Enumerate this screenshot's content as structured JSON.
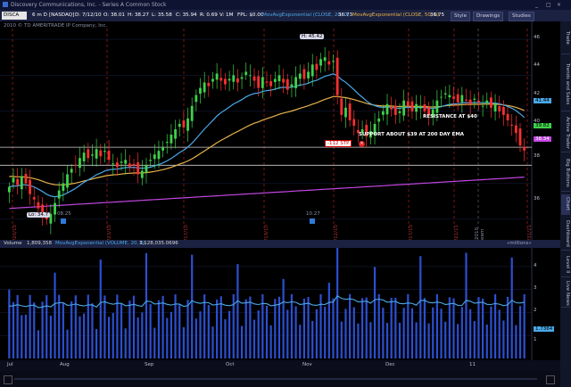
{
  "window": {
    "title": "Discovery Communications, Inc. - Series A Common Stock",
    "controls": [
      "_",
      "□",
      "×"
    ]
  },
  "toolbar": {
    "symbol": "DISCA",
    "timeframe_label": "6 m D",
    "exchange": "[NASDAQ]",
    "date": "D: 7/12/10",
    "open": "O: 38.01",
    "high": "H: 38.27",
    "low": "L: 35.58",
    "close": "C: 35.94",
    "range": "R: 0.69",
    "volume": "V: 1M",
    "fpl": "FPL: $0.00",
    "ema1_label": "MovAvgExponential (CLOSE, 20, 0)",
    "ema1_value": "36.73",
    "ema2_label": "MovAvgExponential (CLOSE, 50, 0)",
    "ema2_value": "36.75",
    "style_button": "Style",
    "drawings_button": "Drawings",
    "studies_button": "Studies"
  },
  "copyright": "2010 © TD AMERITRADE IP Company, Inc.",
  "side_tabs": [
    "Trade",
    "Trends and Sales",
    "Active Trader",
    "Big Buttons",
    "Chart",
    "Dashboard",
    "Level II",
    "Live News"
  ],
  "price_panel": {
    "high_label": "H: 45.42",
    "low_label": "Lo: 34.7",
    "resistance_text": "RESISTANCE AT $40",
    "support_text": "SUPPORT ABOUT $39 AT 200 DAY EMA",
    "stp_label": "-112 STP",
    "price_axis": [
      "46",
      "44",
      "42",
      "40",
      "38",
      "36"
    ],
    "tags": {
      "ema20": "41.44",
      "last": "39.82",
      "ema200": "38.34"
    },
    "date_markers": [
      "7/20/10",
      "8/23/10",
      "9/17/10",
      "10/19/10",
      "11/12/10",
      "12/17/10",
      "1/21/11",
      "2010 earn",
      "1/31/11"
    ],
    "event_markers": [
      "08.25",
      "10.27"
    ]
  },
  "volume_panel": {
    "label_volume": "Volume",
    "volume_value": "1,809,358",
    "ema_label": "MovAvgExponential (VOLUME, 20, 0)",
    "ema_value": "3,128,035.0696",
    "units": "«millions»",
    "axis": [
      "4",
      "3",
      "2",
      "1"
    ],
    "tag": "1.7364"
  },
  "time_axis": [
    "Jul",
    "Aug",
    "Sep",
    "Oct",
    "Nov",
    "Dec",
    "11"
  ],
  "colors": {
    "bg": "#000000",
    "up": "#3fd24a",
    "down": "#ff2f2f",
    "ema20": "#4aa8e8",
    "ema50": "#e8b34a",
    "ema200": "#c247e0",
    "hline": "#d0d0d0",
    "dashed": "#b02020"
  },
  "chart_data": {
    "type": "candlestick",
    "closes": [
      37.8,
      38.3,
      37.9,
      38.4,
      38.0,
      37.4,
      37.1,
      36.6,
      36.2,
      36.0,
      36.3,
      36.9,
      37.6,
      38.0,
      38.5,
      38.8,
      39.0,
      39.4,
      39.7,
      39.4,
      39.6,
      39.9,
      39.5,
      39.8,
      39.3,
      39.1,
      38.9,
      39.2,
      39.3,
      38.9,
      39.0,
      38.5,
      38.7,
      39.0,
      39.3,
      39.6,
      39.8,
      40.0,
      40.3,
      40.7,
      41.0,
      41.3,
      41.1,
      41.6,
      42.3,
      42.9,
      43.3,
      43.6,
      43.4,
      43.8,
      44.1,
      43.7,
      43.5,
      43.8,
      44.0,
      43.6,
      43.9,
      44.2,
      44.0,
      43.7,
      43.3,
      43.9,
      43.6,
      43.4,
      43.8,
      44.0,
      43.6,
      43.2,
      43.5,
      43.9,
      44.1,
      43.8,
      44.2,
      44.6,
      44.3,
      44.9,
      45.0,
      44.6,
      44.8,
      42.9,
      41.8,
      42.2,
      41.5,
      41.2,
      40.8,
      41.0,
      40.6,
      40.9,
      41.3,
      41.6,
      42.0,
      42.4,
      42.1,
      41.8,
      42.0,
      42.6,
      42.3,
      42.0,
      42.4,
      42.3,
      42.0,
      41.8,
      42.1,
      42.6,
      42.8,
      43.0,
      42.9,
      42.7,
      42.5,
      42.9,
      42.6,
      42.4,
      42.7,
      42.5,
      42.3,
      42.6,
      42.2,
      42.4,
      42.0,
      41.8,
      41.5,
      41.2,
      40.8,
      40.1,
      39.82
    ],
    "ema20_end": 41.44,
    "ema50_end": 40.9,
    "ema200_end": 38.34,
    "resistance": 40,
    "support": 39,
    "high": 45.42,
    "low": 34.7,
    "ylim": [
      35.2,
      46.6
    ]
  }
}
